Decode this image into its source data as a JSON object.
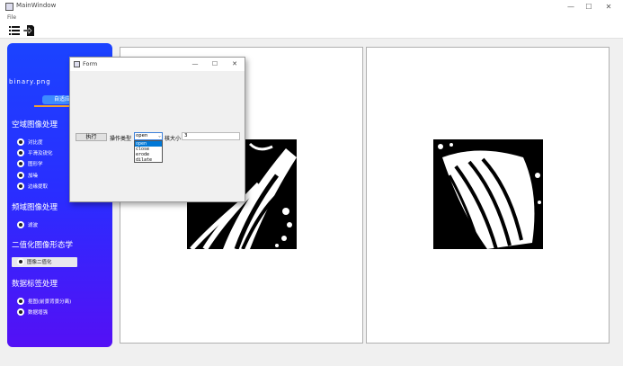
{
  "window": {
    "title": "MainWindow",
    "minimize": "—",
    "maximize": "☐",
    "close": "✕"
  },
  "menu": {
    "file": "File"
  },
  "sidebar": {
    "filename": "binary.png",
    "adapt_button": "自适应",
    "sections": [
      {
        "title": "空域图像处理",
        "items": [
          "对比度",
          "平滑及锐化",
          "图形学",
          "加噪",
          "边缘提取"
        ]
      },
      {
        "title": "频域图像处理",
        "items": [
          "滤波"
        ]
      },
      {
        "title": "二值化图像形态学",
        "items": [
          "图像二值化"
        ]
      },
      {
        "title": "数据标签处理",
        "items": [
          "抠图(前景背景分离)",
          "数据增强"
        ]
      }
    ],
    "active_item": "图像二值化"
  },
  "dialog": {
    "title": "Form",
    "minimize": "—",
    "maximize": "☐",
    "close": "✕",
    "execute_label": "执行",
    "op_type_label": "操作类型",
    "op_selected": "open",
    "op_options": [
      "open",
      "close",
      "erode",
      "dilate"
    ],
    "kernel_label": "核大小",
    "kernel_value": "3"
  },
  "colors": {
    "sidebar_top": "#1b43ff",
    "sidebar_bottom": "#5410f5",
    "accent_line": "#f0a030",
    "selection": "#0078d7"
  }
}
